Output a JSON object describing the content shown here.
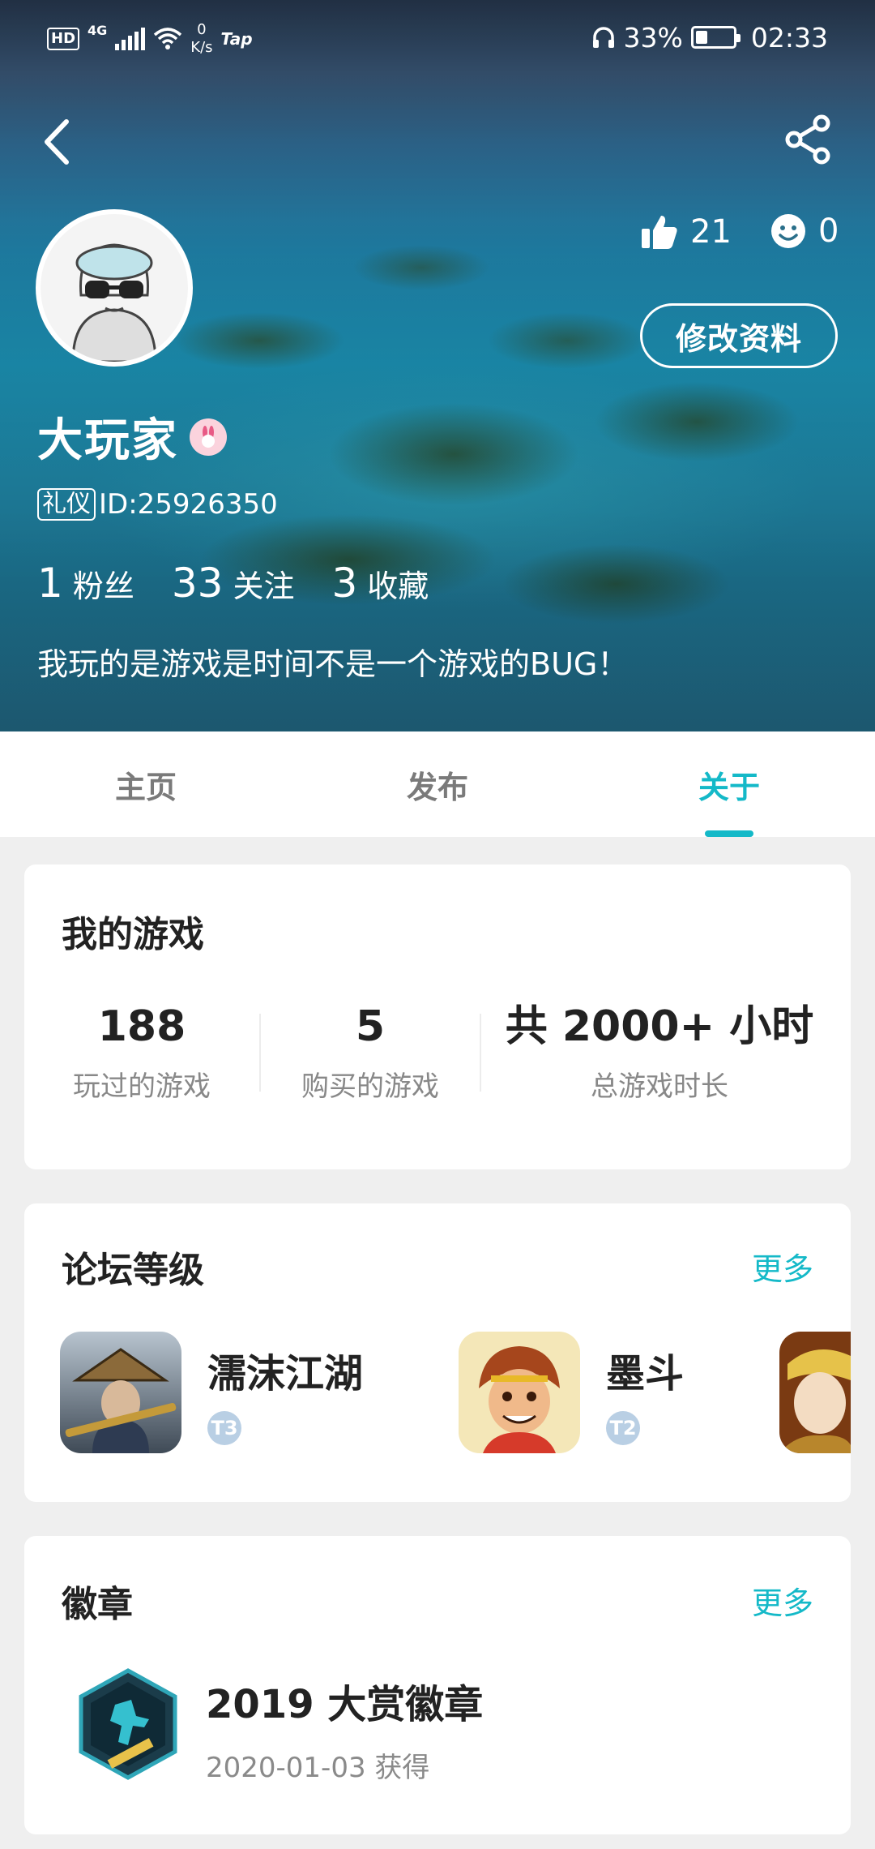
{
  "status_bar": {
    "hd": "HD",
    "network": "4G",
    "speed_value": "0",
    "speed_unit": "K/s",
    "app_tag": "Tap",
    "battery_percent": "33%",
    "battery_level": 0.33,
    "time": "02:33"
  },
  "header": {
    "back_icon": "chevron-left-icon",
    "share_icon": "share-icon"
  },
  "profile": {
    "username": "大玩家",
    "id_tag": "礼仪",
    "id_text": "ID:25926350",
    "likes": "21",
    "smiles": "0",
    "edit_label": "修改资料",
    "bio": "我玩的是游戏是时间不是一个游戏的BUG！",
    "counts": [
      {
        "num": "1",
        "label": "粉丝"
      },
      {
        "num": "33",
        "label": "关注"
      },
      {
        "num": "3",
        "label": "收藏"
      }
    ]
  },
  "tabs": [
    {
      "label": "主页",
      "active": false
    },
    {
      "label": "发布",
      "active": false
    },
    {
      "label": "关于",
      "active": true
    }
  ],
  "my_games": {
    "title": "我的游戏",
    "stats": [
      {
        "value": "188",
        "label": "玩过的游戏"
      },
      {
        "value": "5",
        "label": "购买的游戏"
      },
      {
        "value": "共 2000+ 小时",
        "label": "总游戏时长"
      }
    ]
  },
  "forum": {
    "title": "论坛等级",
    "more": "更多",
    "items": [
      {
        "name": "濡沫江湖",
        "level": "T3"
      },
      {
        "name": "墨斗",
        "level": "T2"
      }
    ]
  },
  "badges": {
    "title": "徽章",
    "more": "更多",
    "items": [
      {
        "name": "2019 大赏徽章",
        "date": "2020-01-03 获得"
      }
    ]
  },
  "colors": {
    "accent": "#14b9c8",
    "text_primary": "#222222",
    "text_secondary": "#888888",
    "page_bg": "#efefef"
  }
}
